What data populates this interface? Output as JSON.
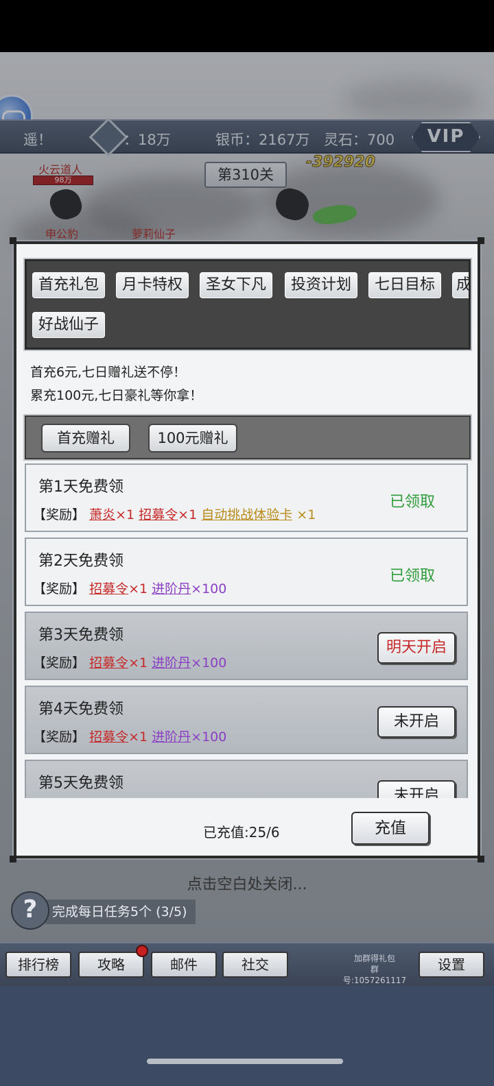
{
  "hud": {
    "player_name_partial": "遥！",
    "power_label": "：18万",
    "silver": "银币：2167万",
    "spirit_stone": "灵石：700",
    "vip": "VIP"
  },
  "battle": {
    "level": "第310关",
    "damage": "-392920",
    "enemy1_name": "火云道人",
    "enemy1_hp": "98万",
    "ally1_name": "申公豹",
    "ally2_name": "萝莉仙子"
  },
  "modal": {
    "tabs": [
      "首充礼包",
      "月卡特权",
      "圣女下凡",
      "投资计划",
      "七日目标",
      "成",
      "好战仙子"
    ],
    "desc_line1": "首充6元,七日赠礼送不停！",
    "desc_line2": "累充100元,七日豪礼等你拿！",
    "sub_tabs": [
      "首充赠礼",
      "100元赠礼"
    ],
    "days": [
      {
        "title": "第1天免费领",
        "reward_label": "【奖励】",
        "items": [
          {
            "name": "萧炎",
            "qty": "×1",
            "color": "red"
          },
          {
            "name": "招募令",
            "qty": "×1",
            "color": "red"
          },
          {
            "name": "自动挑战体验卡",
            "qty": "×1",
            "color": "gold"
          }
        ],
        "status": "已领取"
      },
      {
        "title": "第2天免费领",
        "reward_label": "【奖励】",
        "items": [
          {
            "name": "招募令",
            "qty": "×1",
            "color": "red"
          },
          {
            "name": "进阶丹",
            "qty": "×100",
            "color": "purple"
          }
        ],
        "status": "已领取"
      },
      {
        "title": "第3天免费领",
        "reward_label": "【奖励】",
        "items": [
          {
            "name": "招募令",
            "qty": "×1",
            "color": "red"
          },
          {
            "name": "进阶丹",
            "qty": "×100",
            "color": "purple"
          }
        ],
        "button": "明天开启"
      },
      {
        "title": "第4天免费领",
        "reward_label": "【奖励】",
        "items": [
          {
            "name": "招募令",
            "qty": "×1",
            "color": "red"
          },
          {
            "name": "进阶丹",
            "qty": "×100",
            "color": "purple"
          }
        ],
        "button": "未开启"
      },
      {
        "title": "第5天免费领",
        "button": "未开启"
      }
    ],
    "recharged": "已充值:25/6",
    "recharge_button": "充值"
  },
  "close_hint": "点击空白处关闭...",
  "task": {
    "icon": "?",
    "label": "完成每日任务5个 (3/5)"
  },
  "nav": {
    "rank": "排行榜",
    "guide": "攻略",
    "mail": "邮件",
    "social": "社交",
    "group_line1": "加群得礼包",
    "group_line2": "群号:1057261117",
    "settings": "设置"
  }
}
